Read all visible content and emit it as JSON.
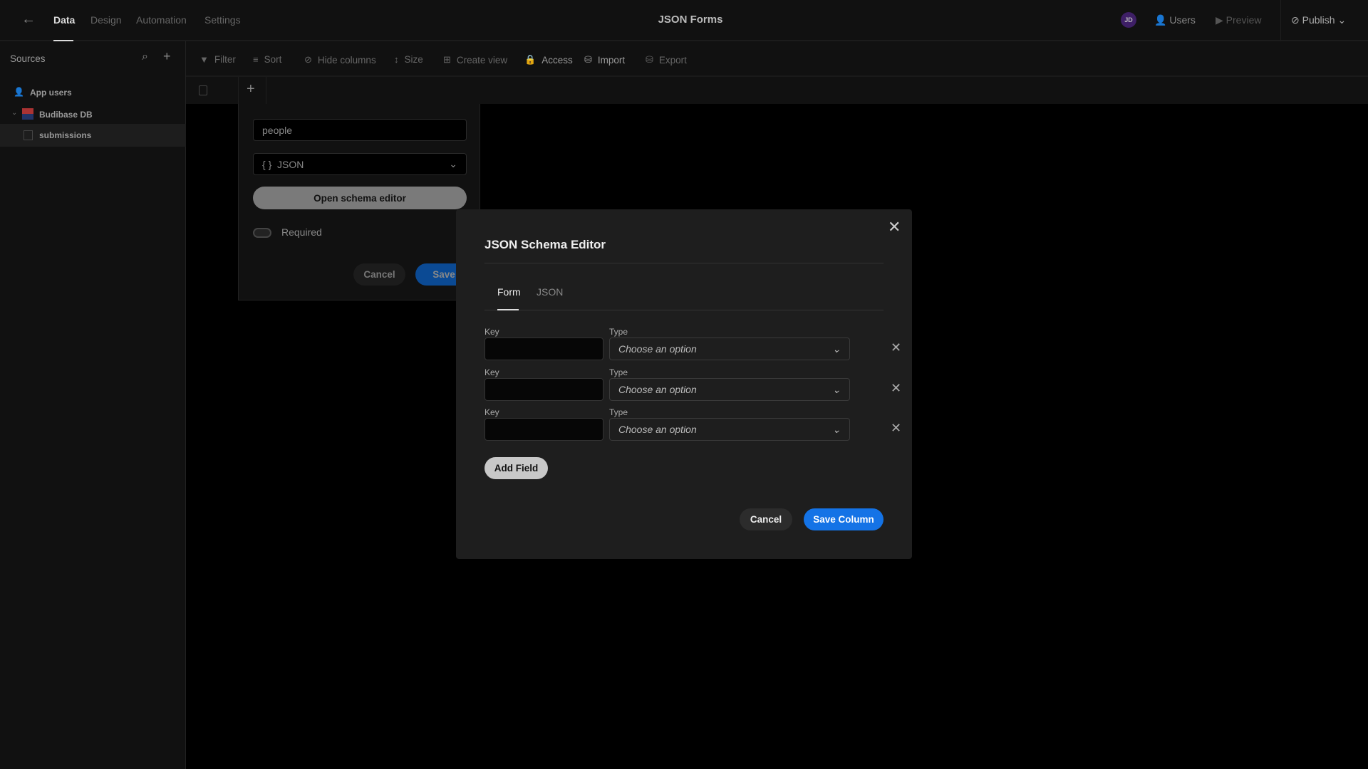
{
  "header": {
    "title": "JSON Forms",
    "tabs": [
      "Data",
      "Design",
      "Automation",
      "Settings"
    ],
    "avatar": "JD",
    "users": "Users",
    "preview": "Preview",
    "publish": "Publish",
    "avatar_color": "#4a2577"
  },
  "sidebar": {
    "title": "Sources",
    "items": [
      {
        "label": "App users"
      },
      {
        "label": "Budibase DB"
      },
      {
        "label": "submissions"
      }
    ]
  },
  "toolbar": {
    "items": [
      "Filter",
      "Sort",
      "Hide columns",
      "Size",
      "Create view",
      "Access",
      "Import",
      "Export"
    ]
  },
  "column_popover": {
    "name_value": "people",
    "type_value": "JSON",
    "type_icon": "{ }",
    "open_editor": "Open schema editor",
    "required": "Required",
    "required_on": false,
    "cancel": "Cancel",
    "save": "Save"
  },
  "modal": {
    "title": "JSON Schema Editor",
    "tabs": [
      "Form",
      "JSON"
    ],
    "active_tab": "Form",
    "fields": [
      {
        "key_label": "Key",
        "type_label": "Type",
        "key": "",
        "type_placeholder": "Choose an option"
      },
      {
        "key_label": "Key",
        "type_label": "Type",
        "key": "",
        "type_placeholder": "Choose an option"
      },
      {
        "key_label": "Key",
        "type_label": "Type",
        "key": "",
        "type_placeholder": "Choose an option"
      }
    ],
    "add_field": "Add Field",
    "cancel": "Cancel",
    "save": "Save Column",
    "accent": "#1473e6"
  }
}
